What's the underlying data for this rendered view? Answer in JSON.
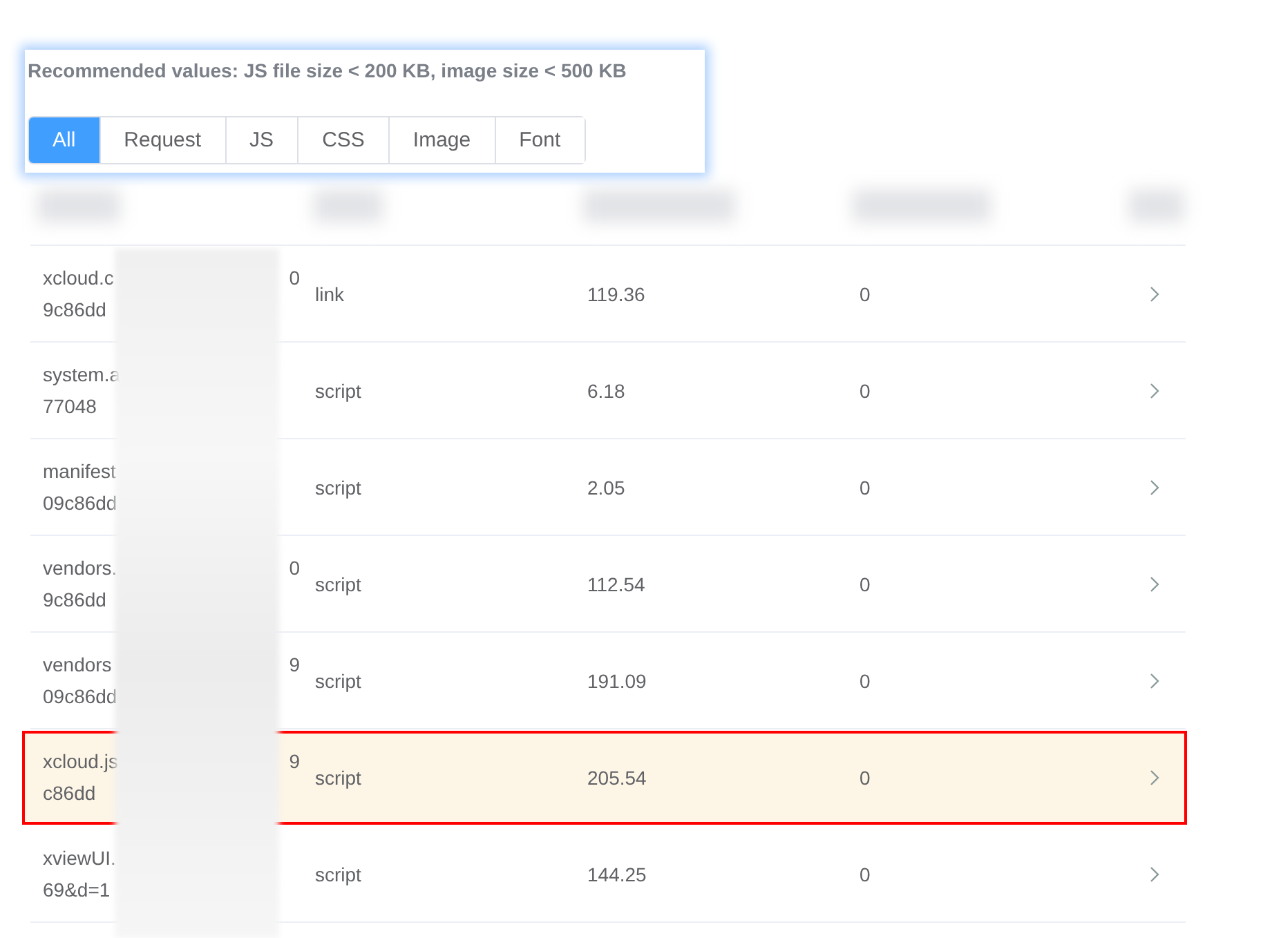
{
  "notice": "Recommended values: JS file size < 200 KB, image size < 500 KB",
  "tabs": [
    {
      "label": "All",
      "selected": true
    },
    {
      "label": "Request",
      "selected": false
    },
    {
      "label": "JS",
      "selected": false
    },
    {
      "label": "CSS",
      "selected": false
    },
    {
      "label": "Image",
      "selected": false
    },
    {
      "label": "Font",
      "selected": false
    }
  ],
  "rows": [
    {
      "name_start": "xcloud.c",
      "name_end": "0",
      "name_line_2": "9c86dd",
      "type": "link",
      "size": "119.36",
      "count": "0",
      "highlighted": false
    },
    {
      "name_start": "system.a",
      "name_line_2": "77048",
      "type": "script",
      "size": "6.18",
      "count": "0",
      "highlighted": false
    },
    {
      "name_start": "manifest",
      "name_line_2": "09c86dd",
      "type": "script",
      "size": "2.05",
      "count": "0",
      "highlighted": false
    },
    {
      "name_start": "vendors.",
      "name_end": "0",
      "name_line_2": "9c86dd",
      "type": "script",
      "size": "112.54",
      "count": "0",
      "highlighted": false
    },
    {
      "name_start": "vendors",
      "name_end": "9",
      "name_line_2": "09c86dd",
      "type": "script",
      "size": "191.09",
      "count": "0",
      "highlighted": false
    },
    {
      "name_start": "xcloud.js",
      "name_end": "9",
      "name_line_2": "c86dd",
      "type": "script",
      "size": "205.54",
      "count": "0",
      "highlighted": true
    },
    {
      "name_start": "xviewUI.",
      "name_line_2": "69&d=1",
      "type": "script",
      "size": "144.25",
      "count": "0",
      "highlighted": false
    }
  ]
}
